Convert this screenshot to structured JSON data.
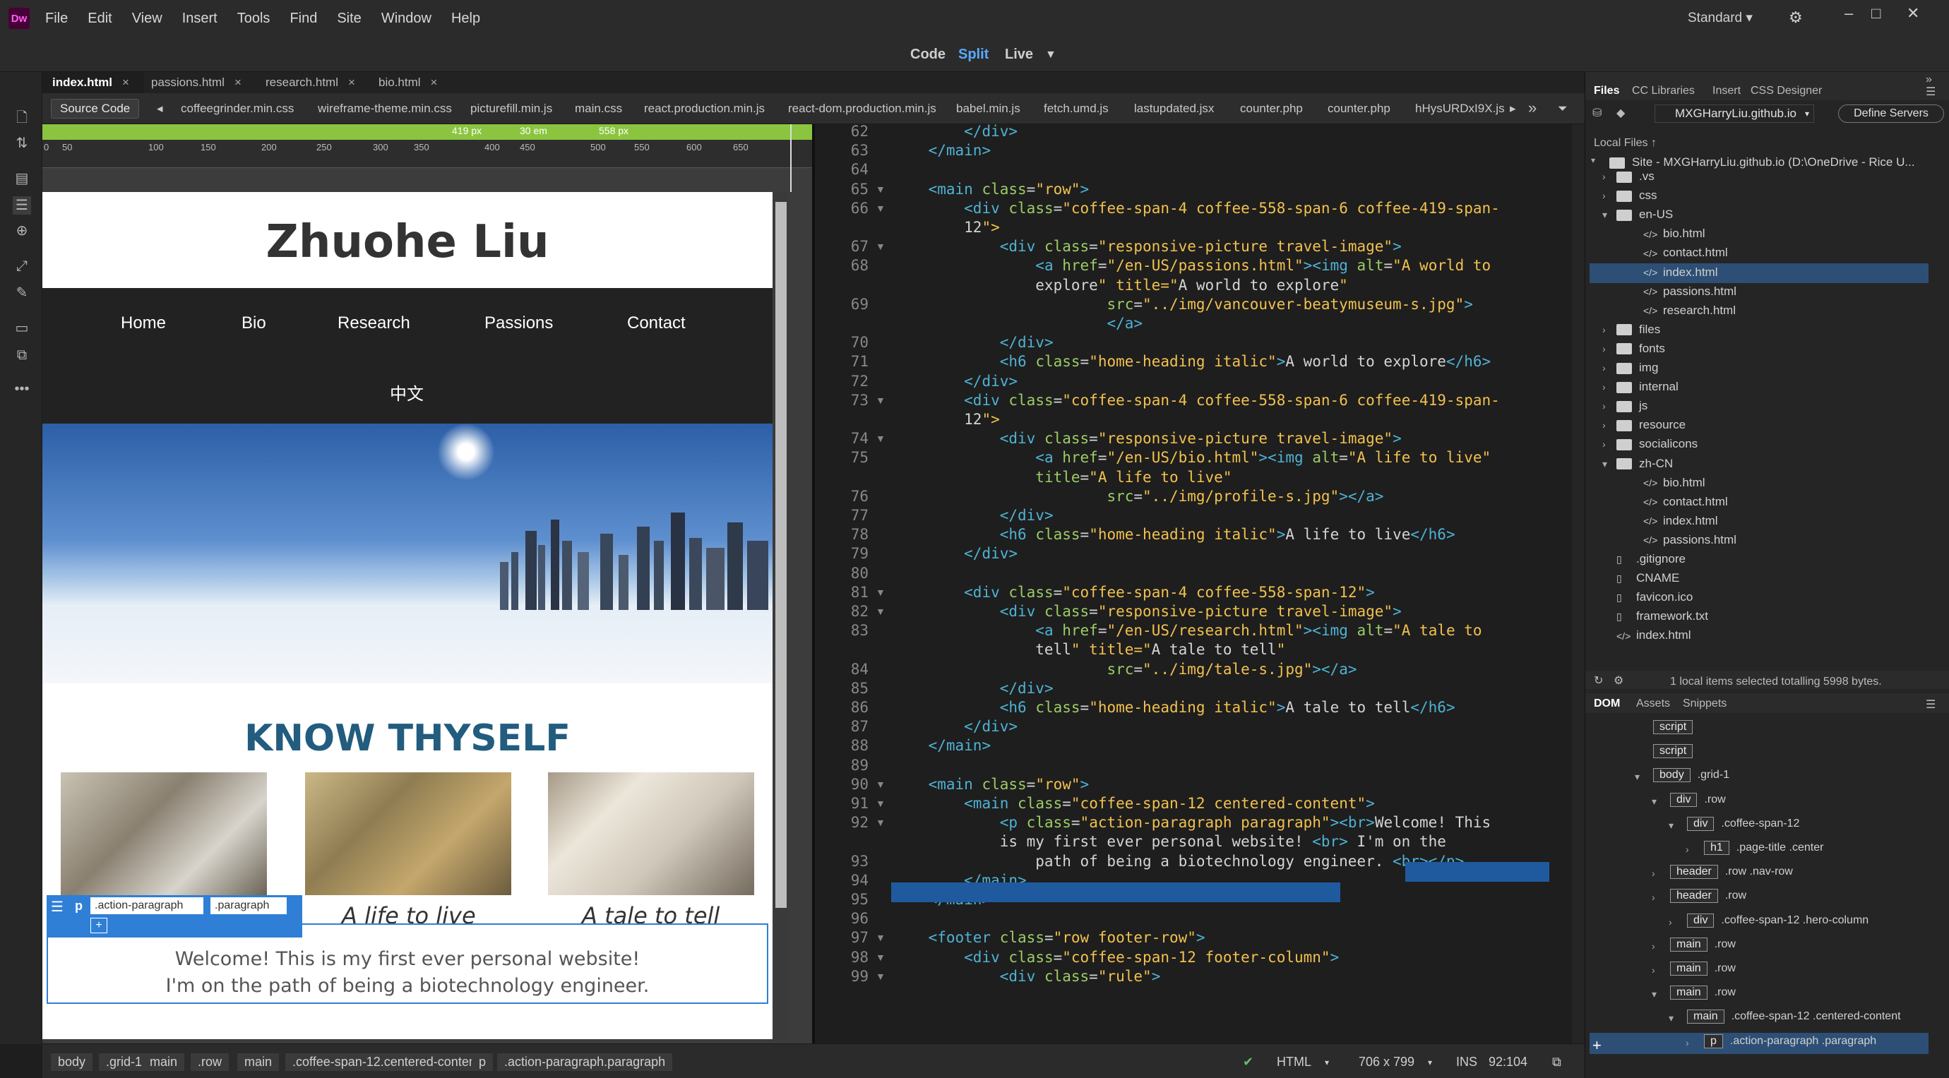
{
  "app": {
    "logo": "Dw",
    "menus": [
      "File",
      "Edit",
      "View",
      "Insert",
      "Tools",
      "Find",
      "Site",
      "Window",
      "Help"
    ],
    "workspace": "Standard"
  },
  "view_modes": {
    "code": "Code",
    "split": "Split",
    "live": "Live",
    "accent": "#5aa9ff"
  },
  "doc_tabs": [
    "index.html",
    "passions.html",
    "research.html",
    "bio.html"
  ],
  "related_files": {
    "source": "Source Code",
    "files": [
      "coffeegrinder.min.css",
      "wireframe-theme.min.css",
      "picturefill.min.js",
      "main.css",
      "react.production.min.js",
      "react-dom.production.min.js",
      "babel.min.js",
      "fetch.umd.js",
      "lastupdated.jsx",
      "counter.php",
      "counter.php",
      "hHysURDxI9X.js"
    ]
  },
  "media_bar": {
    "left": "419 px",
    "mid": "30 em",
    "right": "558 px"
  },
  "ruler": [
    "0",
    "50",
    "100",
    "150",
    "200",
    "250",
    "300",
    "350",
    "400",
    "450",
    "500",
    "550",
    "600",
    "650"
  ],
  "site": {
    "title": "Zhuohe Liu",
    "nav": [
      "Home",
      "Bio",
      "Research",
      "Passions",
      "Contact",
      "中文"
    ],
    "heading": "KNOW THYSELF",
    "captions": [
      "A life to live",
      "A tale to tell"
    ],
    "welcome1": "Welcome! This is my first ever personal website!",
    "welcome2": "I'm on the path of being a biotechnology engineer.",
    "hud": {
      "tag": "p",
      "cls1": ".action-paragraph",
      "cls2": ".paragraph",
      "plus": "+"
    }
  },
  "code_lines": [
    {
      "n": "62",
      "t": "        </div>"
    },
    {
      "n": "63",
      "t": "    </main>"
    },
    {
      "n": "64",
      "t": ""
    },
    {
      "n": "65",
      "t": "    <main class=\"row\">"
    },
    {
      "n": "66",
      "t": "        <div class=\"coffee-span-4 coffee-558-span-6 coffee-419-span-"
    },
    {
      "n": "",
      "t": "        12\">"
    },
    {
      "n": "67",
      "t": "            <div class=\"responsive-picture travel-image\">"
    },
    {
      "n": "68",
      "t": "                <a href=\"/en-US/passions.html\"><img alt=\"A world to"
    },
    {
      "n": "",
      "t": "                explore\" title=\"A world to explore\""
    },
    {
      "n": "69",
      "t": "                        src=\"../img/vancouver-beatymuseum-s.jpg\">"
    },
    {
      "n": "",
      "t": "                        </a>"
    },
    {
      "n": "70",
      "t": "            </div>"
    },
    {
      "n": "71",
      "t": "            <h6 class=\"home-heading italic\">A world to explore</h6>"
    },
    {
      "n": "72",
      "t": "        </div>"
    },
    {
      "n": "73",
      "t": "        <div class=\"coffee-span-4 coffee-558-span-6 coffee-419-span-"
    },
    {
      "n": "",
      "t": "        12\">"
    },
    {
      "n": "74",
      "t": "            <div class=\"responsive-picture travel-image\">"
    },
    {
      "n": "75",
      "t": "                <a href=\"/en-US/bio.html\"><img alt=\"A life to live\""
    },
    {
      "n": "",
      "t": "                title=\"A life to live\""
    },
    {
      "n": "76",
      "t": "                        src=\"../img/profile-s.jpg\"></a>"
    },
    {
      "n": "77",
      "t": "            </div>"
    },
    {
      "n": "78",
      "t": "            <h6 class=\"home-heading italic\">A life to live</h6>"
    },
    {
      "n": "79",
      "t": "        </div>"
    },
    {
      "n": "80",
      "t": ""
    },
    {
      "n": "81",
      "t": "        <div class=\"coffee-span-4 coffee-558-span-12\">"
    },
    {
      "n": "82",
      "t": "            <div class=\"responsive-picture travel-image\">"
    },
    {
      "n": "83",
      "t": "                <a href=\"/en-US/research.html\"><img alt=\"A tale to"
    },
    {
      "n": "",
      "t": "                tell\" title=\"A tale to tell\""
    },
    {
      "n": "84",
      "t": "                        src=\"../img/tale-s.jpg\"></a>"
    },
    {
      "n": "85",
      "t": "            </div>"
    },
    {
      "n": "86",
      "t": "            <h6 class=\"home-heading italic\">A tale to tell</h6>"
    },
    {
      "n": "87",
      "t": "        </div>"
    },
    {
      "n": "88",
      "t": "    </main>"
    },
    {
      "n": "89",
      "t": ""
    },
    {
      "n": "90",
      "t": "    <main class=\"row\">"
    },
    {
      "n": "91",
      "t": "        <main class=\"coffee-span-12 centered-content\">"
    },
    {
      "n": "92",
      "t": "            <p class=\"action-paragraph paragraph\"><br>Welcome! This"
    },
    {
      "n": "",
      "t": "            is my first ever personal website! <br> I'm on the"
    },
    {
      "n": "93",
      "t": "                path of being a biotechnology engineer. <br></p>"
    },
    {
      "n": "94",
      "t": "        </main>"
    },
    {
      "n": "95",
      "t": "    </main>"
    },
    {
      "n": "96",
      "t": ""
    },
    {
      "n": "97",
      "t": "    <footer class=\"row footer-row\">"
    },
    {
      "n": "98",
      "t": "        <div class=\"coffee-span-12 footer-column\">"
    },
    {
      "n": "99",
      "t": "            <div class=\"rule\">"
    }
  ],
  "status": {
    "crumbs": [
      "body",
      ".grid-1",
      "main",
      ".row",
      "main",
      ".coffee-span-12.centered-content",
      "p",
      ".action-paragraph.paragraph"
    ],
    "lang": "HTML",
    "size": "706 x 799",
    "ins": "INS",
    "pos": "92:104"
  },
  "files_panel": {
    "tabs": [
      "Files",
      "CC Libraries",
      "Insert",
      "CSS Designer"
    ],
    "site_select": "MXGHarryLiu.github.io",
    "define": "Define Servers",
    "local": "Local Files",
    "root": "Site - MXGHarryLiu.github.io (D:\\OneDrive - Rice U...",
    "items": [
      {
        "name": ".vs",
        "type": "folder",
        "depth": 1
      },
      {
        "name": "css",
        "type": "folder",
        "depth": 1
      },
      {
        "name": "en-US",
        "type": "folder",
        "depth": 1,
        "open": true
      },
      {
        "name": "bio.html",
        "type": "file",
        "depth": 2
      },
      {
        "name": "contact.html",
        "type": "file",
        "depth": 2
      },
      {
        "name": "index.html",
        "type": "file",
        "depth": 2,
        "selected": true
      },
      {
        "name": "passions.html",
        "type": "file",
        "depth": 2
      },
      {
        "name": "research.html",
        "type": "file",
        "depth": 2
      },
      {
        "name": "files",
        "type": "folder",
        "depth": 1
      },
      {
        "name": "fonts",
        "type": "folder",
        "depth": 1
      },
      {
        "name": "img",
        "type": "folder",
        "depth": 1
      },
      {
        "name": "internal",
        "type": "folder",
        "depth": 1
      },
      {
        "name": "js",
        "type": "folder",
        "depth": 1
      },
      {
        "name": "resource",
        "type": "folder",
        "depth": 1
      },
      {
        "name": "socialicons",
        "type": "folder",
        "depth": 1
      },
      {
        "name": "zh-CN",
        "type": "folder",
        "depth": 1,
        "open": true
      },
      {
        "name": "bio.html",
        "type": "file",
        "depth": 2
      },
      {
        "name": "contact.html",
        "type": "file",
        "depth": 2
      },
      {
        "name": "index.html",
        "type": "file",
        "depth": 2
      },
      {
        "name": "passions.html",
        "type": "file",
        "depth": 2
      },
      {
        "name": ".gitignore",
        "type": "file",
        "depth": 1
      },
      {
        "name": "CNAME",
        "type": "file",
        "depth": 1
      },
      {
        "name": "favicon.ico",
        "type": "file",
        "depth": 1
      },
      {
        "name": "framework.txt",
        "type": "file",
        "depth": 1
      },
      {
        "name": "index.html",
        "type": "file",
        "depth": 1
      }
    ],
    "status": "1 local items selected totalling 5998 bytes."
  },
  "dom_panel": {
    "tabs": [
      "DOM",
      "Assets",
      "Snippets"
    ],
    "rows": [
      {
        "tag": "script",
        "cls": "",
        "indent": 0
      },
      {
        "tag": "script",
        "cls": "",
        "indent": 0
      },
      {
        "tag": "body",
        "cls": ".grid-1",
        "indent": 0
      },
      {
        "tag": "div",
        "cls": ".row",
        "indent": 1
      },
      {
        "tag": "div",
        "cls": ".coffee-span-12",
        "indent": 2
      },
      {
        "tag": "h1",
        "cls": ".page-title .center",
        "indent": 3
      },
      {
        "tag": "header",
        "cls": ".row .nav-row",
        "indent": 1
      },
      {
        "tag": "header",
        "cls": ".row",
        "indent": 1
      },
      {
        "tag": "div",
        "cls": ".coffee-span-12 .hero-column",
        "indent": 2
      },
      {
        "tag": "main",
        "cls": ".row",
        "indent": 1
      },
      {
        "tag": "main",
        "cls": ".row",
        "indent": 1
      },
      {
        "tag": "main",
        "cls": ".row",
        "indent": 1
      },
      {
        "tag": "main",
        "cls": ".coffee-span-12 .centered-content",
        "indent": 2
      },
      {
        "tag": "p",
        "cls": ".action-paragraph .paragraph",
        "indent": 3
      }
    ]
  }
}
